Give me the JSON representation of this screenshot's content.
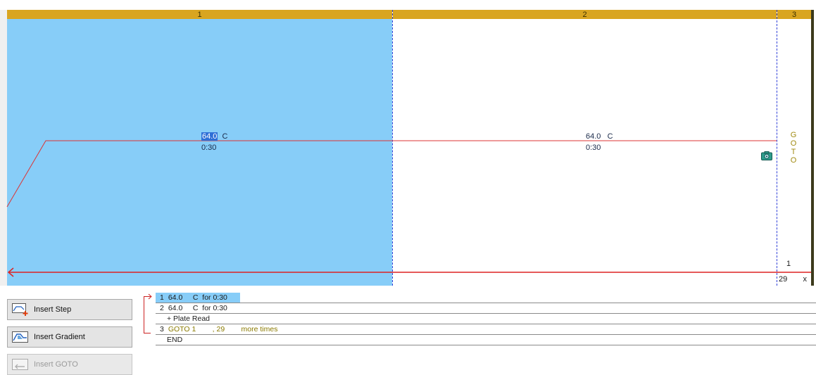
{
  "header": {
    "step_numbers": [
      "1",
      "2",
      "3"
    ]
  },
  "graph": {
    "steps": [
      {
        "temperature": "64.0",
        "unit": "C",
        "time": "0:30"
      },
      {
        "temperature": "64.0",
        "unit": "C",
        "time": "0:30"
      }
    ],
    "goto_letters": [
      "G",
      "O",
      "T",
      "O"
    ],
    "goto_target": "1",
    "cycle_count": "29",
    "cycle_suffix": "x"
  },
  "toolbar": {
    "insert_step": "Insert Step",
    "insert_gradient": "Insert Gradient",
    "insert_goto": "Insert GOTO"
  },
  "step_list": [
    {
      "num": "1",
      "text": "64.0     C  for 0:30"
    },
    {
      "num": "2",
      "text": "64.0     C  for 0:30"
    },
    {
      "num": "",
      "text": "+ Plate Read"
    },
    {
      "num": "3",
      "text": "GOTO 1        , 29        more times"
    },
    {
      "num": "",
      "text": "END"
    }
  ],
  "colors": {
    "header": "#d9a520",
    "selected_step": "#87cdf8",
    "temperature_line": "#dd3333",
    "goto_text": "#a08a10",
    "step_divider": "#2f3fd8"
  }
}
